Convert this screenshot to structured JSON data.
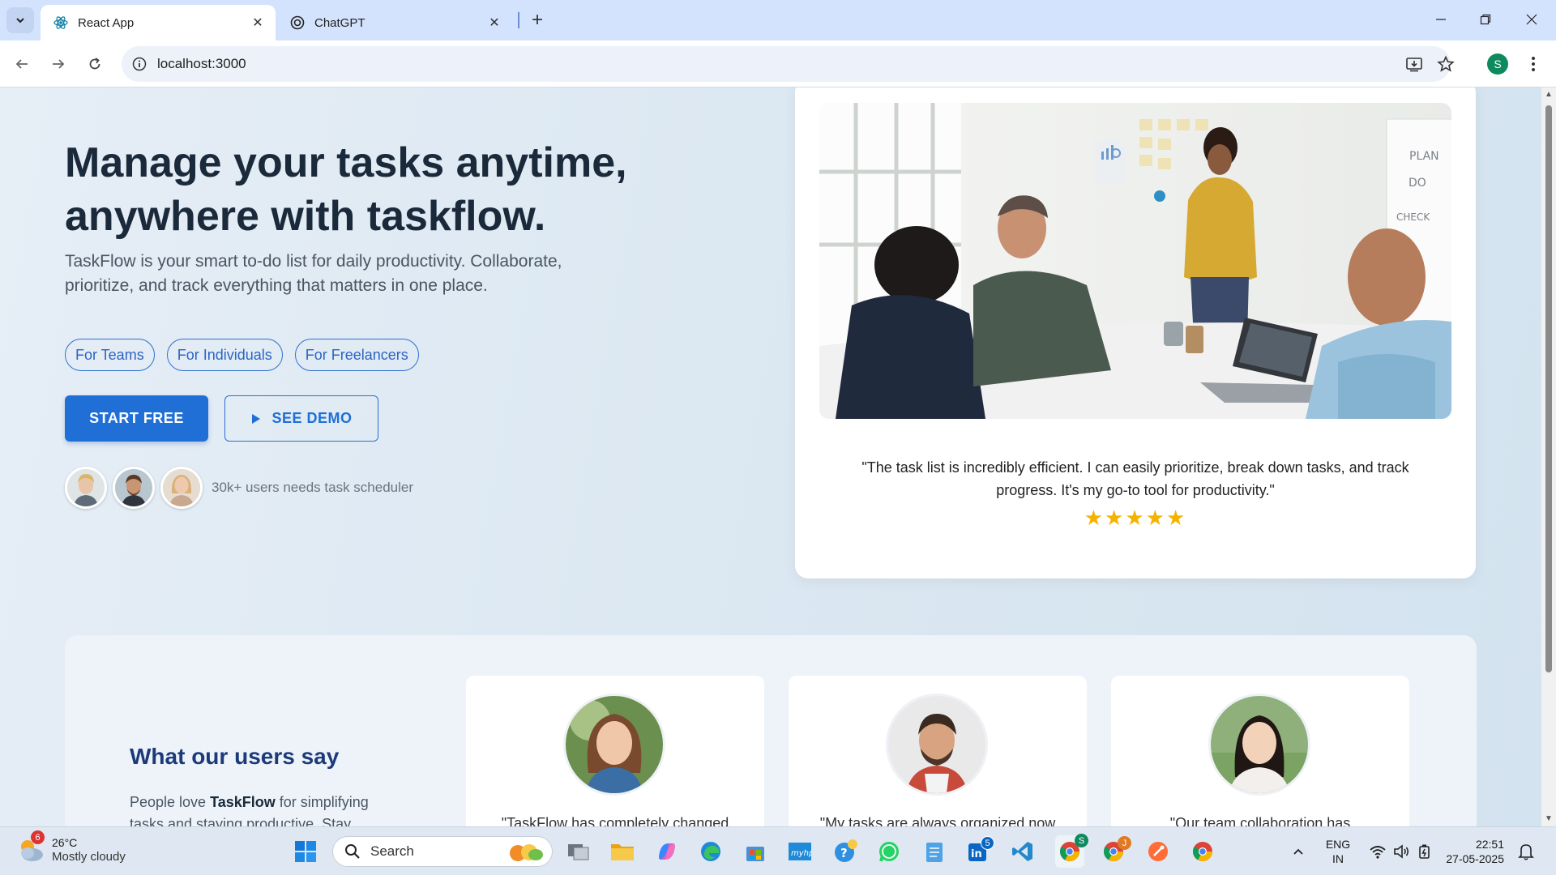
{
  "browser": {
    "tabs": [
      {
        "title": "React App",
        "active": true
      },
      {
        "title": "ChatGPT",
        "active": false
      }
    ],
    "url": "localhost:3000",
    "profile_initial": "S"
  },
  "hero": {
    "title": "Manage your tasks anytime, anywhere with taskflow.",
    "subtitle": "TaskFlow is your smart to-do list for daily productivity. Collaborate, prioritize, and track everything that matters in one place.",
    "pills": [
      "For Teams",
      "For Individuals",
      "For Freelancers"
    ],
    "start_label": "START FREE",
    "demo_label": "SEE DEMO",
    "users_text": "30k+ users needs task scheduler"
  },
  "testimonial": {
    "quote": "\"The task list is incredibly efficient. I can easily prioritize, break down tasks, and track progress. It's my go-to tool for productivity.\"",
    "stars": "★★★★★",
    "rating": 5,
    "whiteboard_text": [
      "PLAN",
      "DO",
      "CHECK"
    ]
  },
  "reviews": {
    "heading": "What our users say",
    "text_prefix": "People love ",
    "text_brand": "TaskFlow",
    "text_suffix": " for simplifying tasks and staying productive. Stay",
    "cards": [
      {
        "quote": "\"TaskFlow has completely changed"
      },
      {
        "quote": "\"My tasks are always organized now"
      },
      {
        "quote": "\"Our team collaboration has"
      }
    ]
  },
  "taskbar": {
    "weather_badge": "6",
    "temperature": "26°C",
    "condition": "Mostly cloudy",
    "search_placeholder": "Search",
    "linkedin_badge": "5",
    "chrome_badge": "S",
    "chrome2_badge": "J",
    "language": "ENG",
    "region": "IN",
    "time": "22:51",
    "date": "27-05-2025"
  },
  "colors": {
    "primary": "#1f6fd6",
    "heading": "#1b2a3b",
    "reviews_heading": "#1c3a7a",
    "star": "#f5b301"
  }
}
